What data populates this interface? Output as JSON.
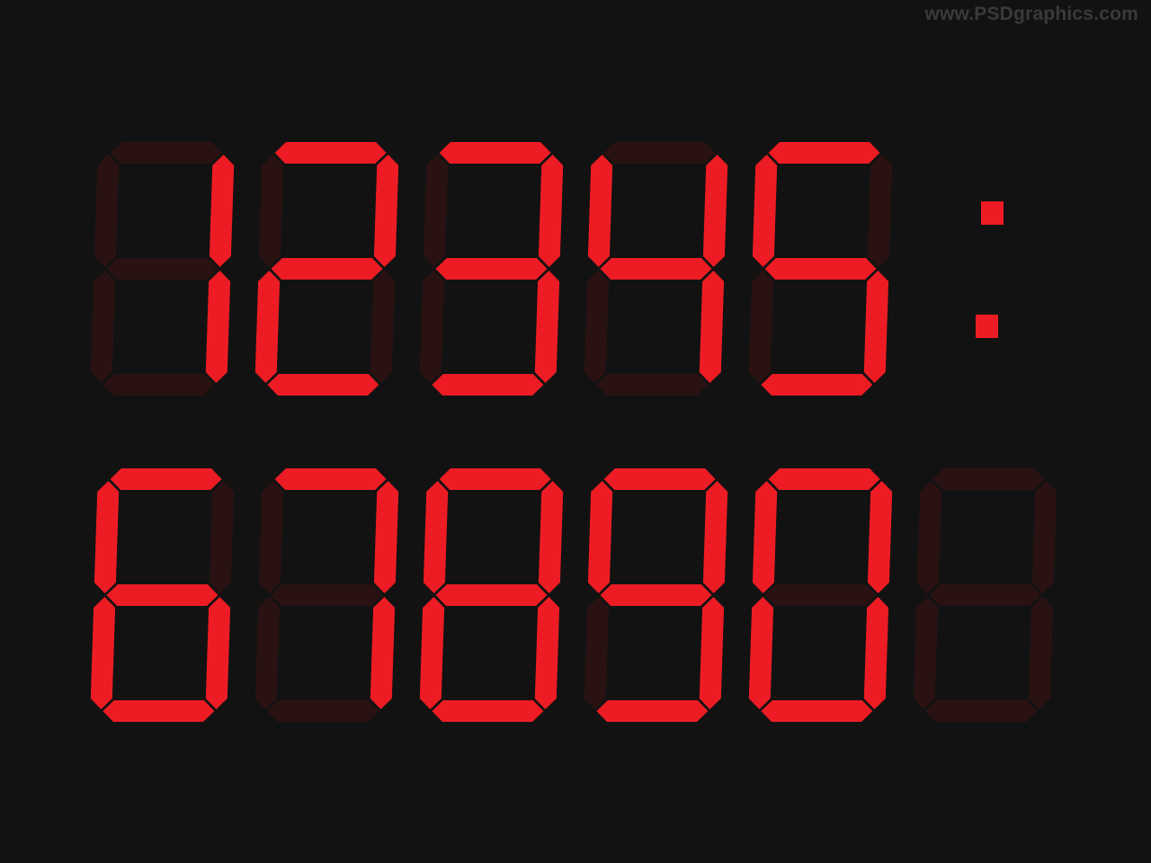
{
  "watermark": "www.PSDgraphics.com",
  "colors": {
    "background": "#121212",
    "segment_on": "#ed1c24",
    "segment_off": "#2a1212"
  },
  "display": {
    "rows": [
      {
        "name": "row-top",
        "digits": [
          {
            "glyph": "1",
            "segments": "bc"
          },
          {
            "glyph": "2",
            "segments": "abged"
          },
          {
            "glyph": "3",
            "segments": "abgcd"
          },
          {
            "glyph": "4",
            "segments": "fgbc"
          },
          {
            "glyph": "5",
            "segments": "afgcd"
          }
        ],
        "separator": ":"
      },
      {
        "name": "row-bottom",
        "digits": [
          {
            "glyph": "6",
            "segments": "afgedc"
          },
          {
            "glyph": "7",
            "segments": "abc"
          },
          {
            "glyph": "8",
            "segments": "abcdefg"
          },
          {
            "glyph": "9",
            "segments": "abcdfg"
          },
          {
            "glyph": "0",
            "segments": "abcdef"
          },
          {
            "glyph": "",
            "segments": ""
          }
        ]
      }
    ]
  }
}
